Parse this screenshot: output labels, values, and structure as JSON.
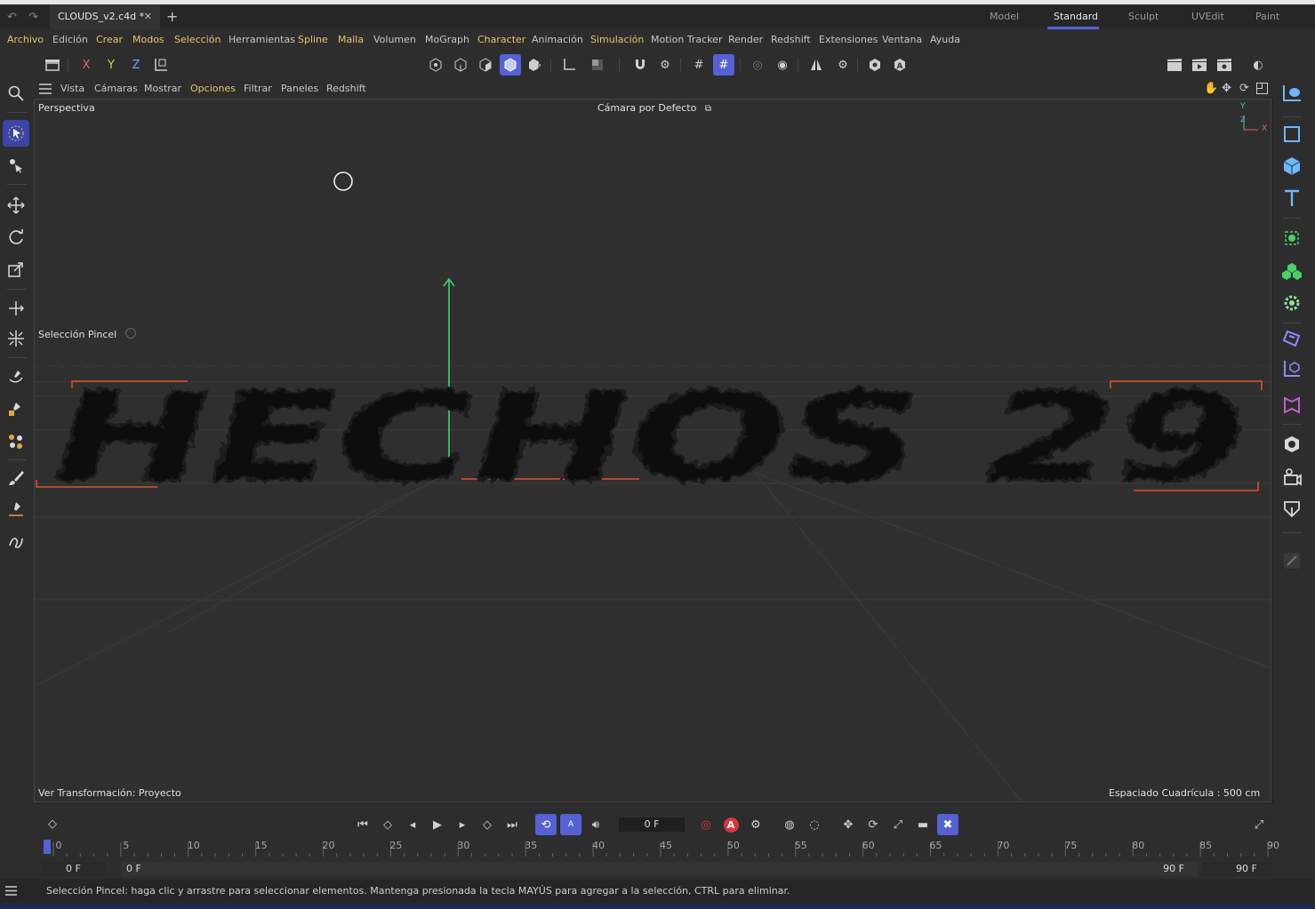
{
  "window": {
    "doc_tab_title": "CLOUDS_v2.c4d *",
    "close_glyph": "✕",
    "add_glyph": "+",
    "workspaces": [
      "Model",
      "Standard",
      "Sculpt",
      "UVEdit",
      "Paint"
    ],
    "active_workspace": "Standard"
  },
  "menu": {
    "items": [
      {
        "label": "Archivo",
        "accent": "yellow"
      },
      {
        "label": "Edición",
        "accent": "white"
      },
      {
        "label": "Crear",
        "accent": "yellow"
      },
      {
        "label": "Modos",
        "accent": "yellow"
      },
      {
        "label": "Selección",
        "accent": "yellow"
      },
      {
        "label": "Herramientas",
        "accent": "white"
      },
      {
        "label": "Spline",
        "accent": "yellow"
      },
      {
        "label": "Malla",
        "accent": "yellow"
      },
      {
        "label": "Volumen",
        "accent": "white"
      },
      {
        "label": "MoGraph",
        "accent": "white"
      },
      {
        "label": "Character",
        "accent": "yellow"
      },
      {
        "label": "Animación",
        "accent": "white"
      },
      {
        "label": "Simulación",
        "accent": "yellow"
      },
      {
        "label": "Motion Tracker",
        "accent": "white"
      },
      {
        "label": "Render",
        "accent": "white"
      },
      {
        "label": "Redshift",
        "accent": "white"
      },
      {
        "label": "Extensiones",
        "accent": "white"
      },
      {
        "label": "Ventana",
        "accent": "white"
      },
      {
        "label": "Ayuda",
        "accent": "white"
      }
    ]
  },
  "toolbar": {
    "axis_x": "X",
    "axis_y": "Y",
    "axis_z": "Z"
  },
  "viewport_menu": {
    "items": [
      "Vista",
      "Cámaras",
      "Mostrar",
      "Opciones",
      "Filtrar",
      "Paneles",
      "Redshift"
    ],
    "active": "Opciones"
  },
  "viewport": {
    "view_name": "Perspectiva",
    "camera": "Cámara por Defecto",
    "tool_name": "Selección Pincel",
    "transform_info": "Ver Transformación: Proyecto",
    "grid_spacing": "Espaciado Cuadrícula : 500 cm",
    "axis_y_label": "Y",
    "axis_x_label": "X",
    "axis_z_label": "Z",
    "scene_text": "HECHOS 29"
  },
  "timeline": {
    "current_frame": "0 F",
    "ticks": [
      0,
      5,
      10,
      15,
      20,
      25,
      30,
      35,
      40,
      45,
      50,
      55,
      60,
      65,
      70,
      75,
      80,
      85,
      90
    ],
    "range_start": "0 F",
    "range_start_inner": "0 F",
    "range_end_inner": "90 F",
    "range_end": "90 F",
    "record_label": "A"
  },
  "status": {
    "message": "Selección Pincel: haga clic y arrastre para seleccionar elementos. Mantenga presionada la tecla MAYÚS para agregar a la selección, CTRL para eliminar."
  },
  "colors": {
    "accent": "#5561d4",
    "menu_yellow": "#e6c56a",
    "axis_green": "#3fd07a",
    "bbox_orange": "#e8502a",
    "record_red": "#d9363e"
  }
}
